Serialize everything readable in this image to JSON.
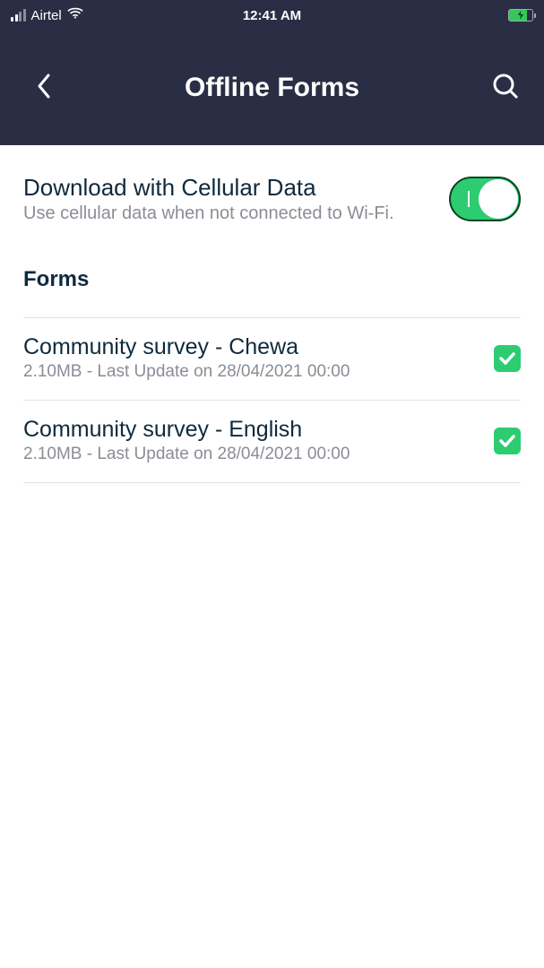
{
  "status": {
    "carrier": "Airtel",
    "time": "12:41 AM"
  },
  "nav": {
    "title": "Offline Forms"
  },
  "cellular": {
    "title": "Download with Cellular Data",
    "subtitle": "Use cellular data when not connected to Wi-Fi.",
    "enabled": true
  },
  "sections": {
    "forms_header": "Forms"
  },
  "forms": [
    {
      "name": "Community survey - Chewa",
      "meta": "2.10MB - Last Update on 28/04/2021 00:00",
      "checked": true
    },
    {
      "name": "Community survey - English",
      "meta": "2.10MB - Last Update on 28/04/2021 00:00",
      "checked": true
    }
  ]
}
